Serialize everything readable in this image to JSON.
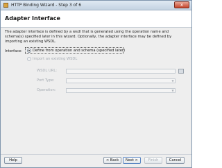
{
  "window": {
    "title": "HTTP Binding Wizard - Step 3 of 6",
    "close_glyph": "x"
  },
  "header": {
    "title": "Adapter Interface"
  },
  "description": "The adapter interface is defined by a wsdl that is generated using the operation name and schema(s) specified later in this wizard.  Optionally, the adapter interface may be defined by importing an existing WSDL.",
  "interface": {
    "label": "Interface:",
    "options": [
      {
        "label": "Define from operation and schema (specified later)",
        "selected": true,
        "enabled": true
      },
      {
        "label": "Import an existing WSDL",
        "selected": false,
        "enabled": false
      }
    ],
    "wsdl_url_label": "WSDL URL:",
    "port_type_label": "Port Type:",
    "operation_label": "Operation:",
    "wsdl_url_value": "",
    "port_type_value": "",
    "operation_value": ""
  },
  "buttons": {
    "help": "Help",
    "back": "< Back",
    "next": "Next >",
    "finish": "Finish",
    "cancel": "Cancel"
  },
  "icons": {
    "app": "wizard-app-icon",
    "browse": "browse-icon",
    "close": "close-icon"
  }
}
